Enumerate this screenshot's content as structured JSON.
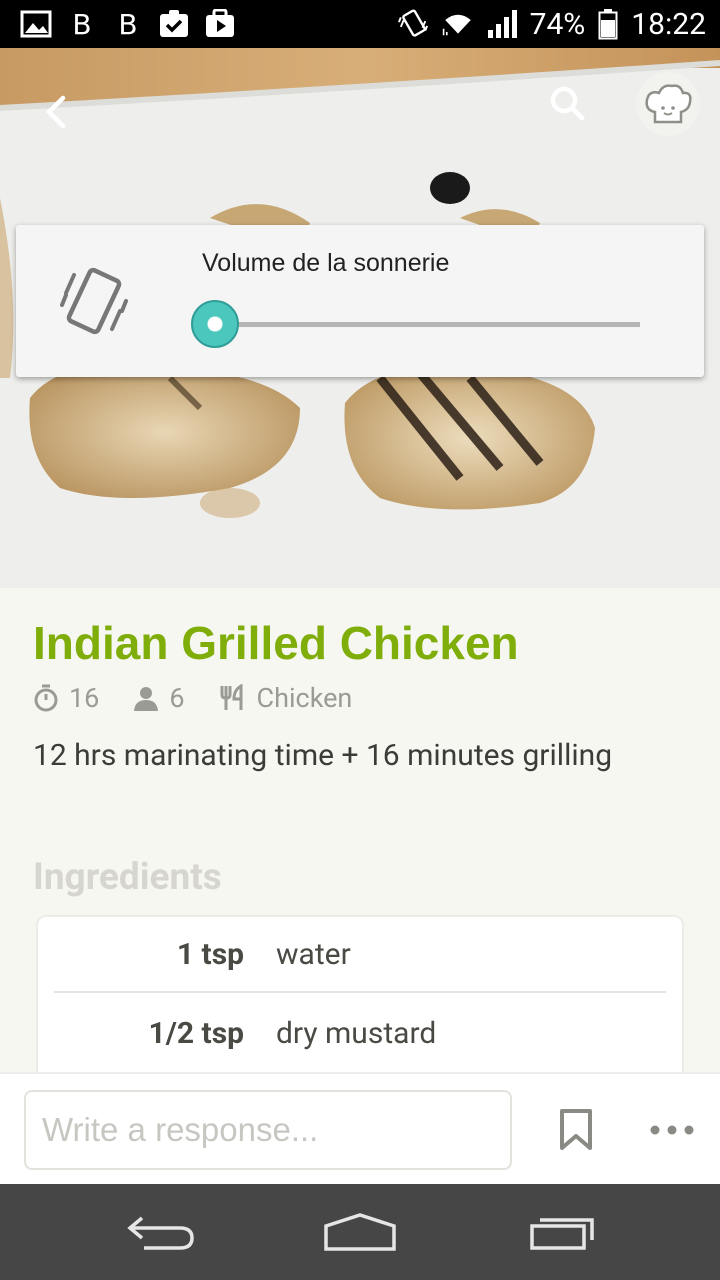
{
  "status_bar": {
    "battery": "74%",
    "time": "18:22",
    "icons": [
      "image-icon",
      "b-icon",
      "b-icon",
      "clipboard-check-icon",
      "play-store-icon",
      "vibrate-icon",
      "wifi-icon",
      "signal-icon",
      "battery-icon"
    ],
    "b_letter": "B"
  },
  "header": {
    "back_icon": "chevron-left-icon",
    "search_icon": "search-icon",
    "profile_icon": "chef-hat-icon"
  },
  "volume_dialog": {
    "title": "Volume de la sonnerie",
    "icon": "vibrate-phone-icon",
    "level": 0.03,
    "accent": "#3bb8b0"
  },
  "recipe": {
    "title": "Indian Grilled Chicken",
    "title_color": "#7fad0a",
    "cook_time": "16",
    "servings": "6",
    "category": "Chicken",
    "description": "12 hrs marinating time + 16 minutes grilling"
  },
  "ingredients": {
    "heading": "Ingredients",
    "items": [
      {
        "qty": "1 tsp",
        "name": "water"
      },
      {
        "qty": "1/2 tsp",
        "name": "dry mustard"
      }
    ]
  },
  "reply": {
    "placeholder": "Write a response..."
  },
  "nav": {
    "back": "nav-back-icon",
    "home": "nav-home-icon",
    "recents": "nav-recents-icon"
  }
}
